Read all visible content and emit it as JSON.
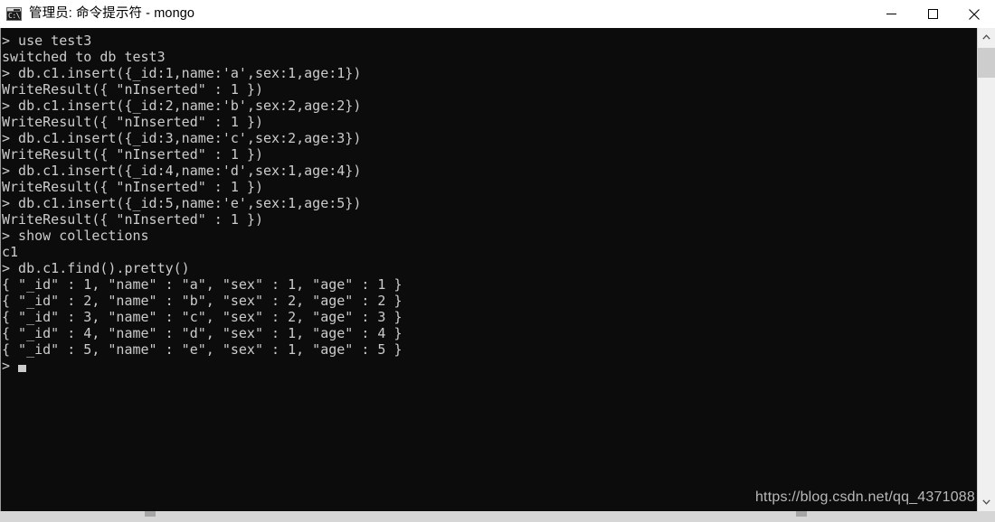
{
  "window": {
    "title": "管理员: 命令提示符 - mongo",
    "icon_name": "cmd-console-icon",
    "icon_label": "C:\\",
    "controls": {
      "minimize": "—",
      "maximize": "□",
      "close": "✕"
    }
  },
  "colors": {
    "titlebar_bg": "#ffffff",
    "console_bg": "#0c0c0c",
    "console_fg": "#cccccc",
    "scrollbar_track": "#f0f0f0",
    "scrollbar_thumb": "#cdcdcd",
    "watermark_fg": "#b9b9b9"
  },
  "terminal": {
    "lines": [
      "> use test3",
      "switched to db test3",
      "> db.c1.insert({_id:1,name:'a',sex:1,age:1})",
      "WriteResult({ \"nInserted\" : 1 })",
      "> db.c1.insert({_id:2,name:'b',sex:2,age:2})",
      "WriteResult({ \"nInserted\" : 1 })",
      "> db.c1.insert({_id:3,name:'c',sex:2,age:3})",
      "WriteResult({ \"nInserted\" : 1 })",
      "> db.c1.insert({_id:4,name:'d',sex:1,age:4})",
      "WriteResult({ \"nInserted\" : 1 })",
      "> db.c1.insert({_id:5,name:'e',sex:1,age:5})",
      "WriteResult({ \"nInserted\" : 1 })",
      "> show collections",
      "c1",
      "> db.c1.find().pretty()",
      "{ \"_id\" : 1, \"name\" : \"a\", \"sex\" : 1, \"age\" : 1 }",
      "{ \"_id\" : 2, \"name\" : \"b\", \"sex\" : 2, \"age\" : 2 }",
      "{ \"_id\" : 3, \"name\" : \"c\", \"sex\" : 2, \"age\" : 3 }",
      "{ \"_id\" : 4, \"name\" : \"d\", \"sex\" : 1, \"age\" : 4 }",
      "{ \"_id\" : 5, \"name\" : \"e\", \"sex\" : 1, \"age\" : 5 }"
    ],
    "prompt": ">",
    "cursor_visible": true
  },
  "watermark": {
    "text": "https://blog.csdn.net/qq_4371088"
  },
  "scrollbars": {
    "vertical": {
      "up_arrow": "⌃",
      "down_arrow": "⌄"
    },
    "horizontal": {
      "corner_arrow": "⌄"
    }
  }
}
